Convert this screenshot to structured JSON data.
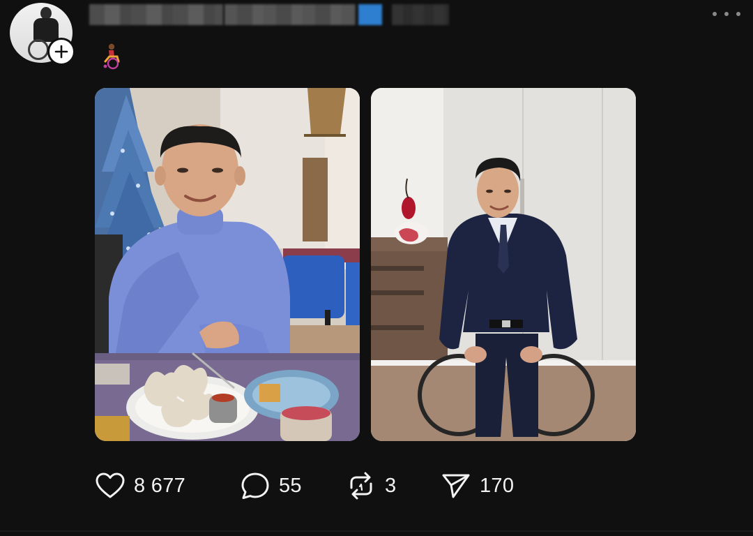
{
  "post": {
    "author": {
      "avatar_icon": "avatar-photo",
      "follow_icon": "plus-icon",
      "badge_emoji": "person-in-wheelchair-emoji"
    },
    "menu_icon": "more-icon",
    "images": [
      {
        "icon": "photo-man-in-blue-sweater-at-restaurant"
      },
      {
        "icon": "photo-man-in-suit-in-wheelchair"
      }
    ]
  },
  "actions": {
    "like": {
      "icon": "heart-icon",
      "count": "8 677"
    },
    "comment": {
      "icon": "comment-icon",
      "count": "55"
    },
    "repost": {
      "icon": "repost-icon",
      "count": "3"
    },
    "share": {
      "icon": "send-icon",
      "count": "170"
    }
  },
  "colors": {
    "background": "#101010",
    "text": "#f3f3f3",
    "blurred_name_accent": "#2f7fd0"
  }
}
